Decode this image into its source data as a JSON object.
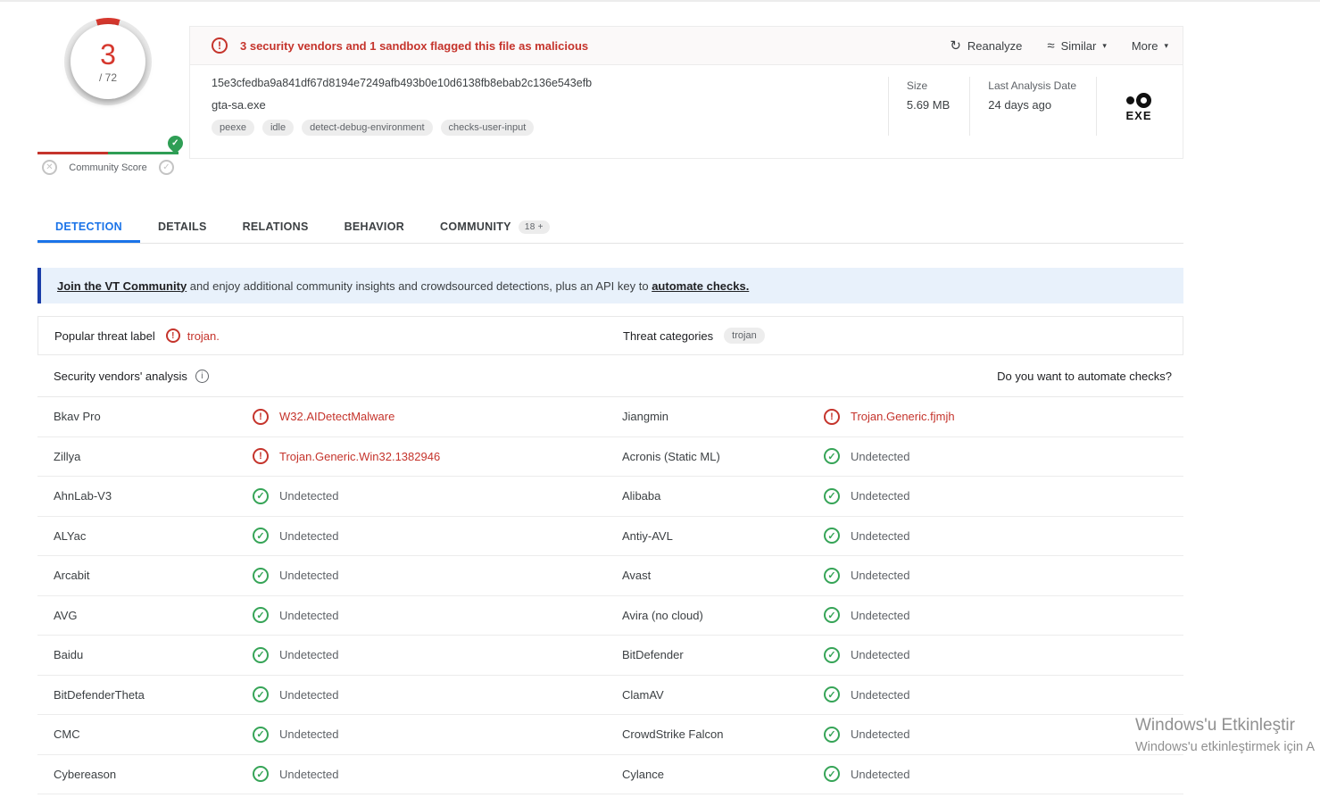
{
  "colors": {
    "malicious_red": "#c5342c",
    "score_red": "#d6382e",
    "undetected_green": "#36a457",
    "active_tab_blue": "#1a73e8",
    "banner_bg": "#e8f1fb",
    "banner_accent": "#1a3da8"
  },
  "score_widget": {
    "score": "3",
    "total": "/ 72",
    "community_label": "Community Score"
  },
  "header": {
    "alert_text": "3 security vendors and 1 sandbox flagged this file as malicious",
    "actions": {
      "reanalyze": "Reanalyze",
      "similar": "Similar",
      "more": "More"
    },
    "file": {
      "hash": "15e3cfedba9a841df67d8194e7249afb493b0e10d6138fb8ebab2c136e543efb",
      "name": "gta-sa.exe",
      "tags": [
        "peexe",
        "idle",
        "detect-debug-environment",
        "checks-user-input"
      ],
      "size_label": "Size",
      "size_value": "5.69 MB",
      "last_analysis_label": "Last Analysis Date",
      "last_analysis_value": "24 days ago",
      "type_badge": "EXE"
    }
  },
  "tabs": [
    {
      "label": "DETECTION",
      "active": true
    },
    {
      "label": "DETAILS",
      "active": false
    },
    {
      "label": "RELATIONS",
      "active": false
    },
    {
      "label": "BEHAVIOR",
      "active": false
    },
    {
      "label": "COMMUNITY",
      "active": false,
      "badge": "18 +"
    }
  ],
  "banner": {
    "link_community": "Join the VT Community",
    "middle": " and enjoy additional community insights and crowdsourced detections, plus an API key to ",
    "link_automate": "automate checks."
  },
  "threat": {
    "popular_label": "Popular threat label",
    "popular_value": "trojan.",
    "categories_label": "Threat categories",
    "category_tag": "trojan"
  },
  "analysis": {
    "title": "Security vendors' analysis",
    "automate_question": "Do you want to automate checks?"
  },
  "table": {
    "rows": [
      {
        "cells": [
          {
            "vendor": "Bkav Pro",
            "result": "W32.AIDetectMalware",
            "status": "malicious"
          },
          {
            "vendor": "Jiangmin",
            "result": "Trojan.Generic.fjmjh",
            "status": "malicious"
          }
        ]
      },
      {
        "cells": [
          {
            "vendor": "Zillya",
            "result": "Trojan.Generic.Win32.1382946",
            "status": "malicious"
          },
          {
            "vendor": "Acronis (Static ML)",
            "result": "Undetected",
            "status": "undetected"
          }
        ]
      },
      {
        "cells": [
          {
            "vendor": "AhnLab-V3",
            "result": "Undetected",
            "status": "undetected"
          },
          {
            "vendor": "Alibaba",
            "result": "Undetected",
            "status": "undetected"
          }
        ]
      },
      {
        "cells": [
          {
            "vendor": "ALYac",
            "result": "Undetected",
            "status": "undetected"
          },
          {
            "vendor": "Antiy-AVL",
            "result": "Undetected",
            "status": "undetected"
          }
        ]
      },
      {
        "cells": [
          {
            "vendor": "Arcabit",
            "result": "Undetected",
            "status": "undetected"
          },
          {
            "vendor": "Avast",
            "result": "Undetected",
            "status": "undetected"
          }
        ]
      },
      {
        "cells": [
          {
            "vendor": "AVG",
            "result": "Undetected",
            "status": "undetected"
          },
          {
            "vendor": "Avira (no cloud)",
            "result": "Undetected",
            "status": "undetected"
          }
        ]
      },
      {
        "cells": [
          {
            "vendor": "Baidu",
            "result": "Undetected",
            "status": "undetected"
          },
          {
            "vendor": "BitDefender",
            "result": "Undetected",
            "status": "undetected"
          }
        ]
      },
      {
        "cells": [
          {
            "vendor": "BitDefenderTheta",
            "result": "Undetected",
            "status": "undetected"
          },
          {
            "vendor": "ClamAV",
            "result": "Undetected",
            "status": "undetected"
          }
        ]
      },
      {
        "cells": [
          {
            "vendor": "CMC",
            "result": "Undetected",
            "status": "undetected"
          },
          {
            "vendor": "CrowdStrike Falcon",
            "result": "Undetected",
            "status": "undetected"
          }
        ]
      },
      {
        "cells": [
          {
            "vendor": "Cybereason",
            "result": "Undetected",
            "status": "undetected"
          },
          {
            "vendor": "Cylance",
            "result": "Undetected",
            "status": "undetected"
          }
        ]
      }
    ]
  },
  "watermark": {
    "line1": "Windows'u Etkinleştir",
    "line2": "Windows'u etkinleştirmek için A"
  }
}
